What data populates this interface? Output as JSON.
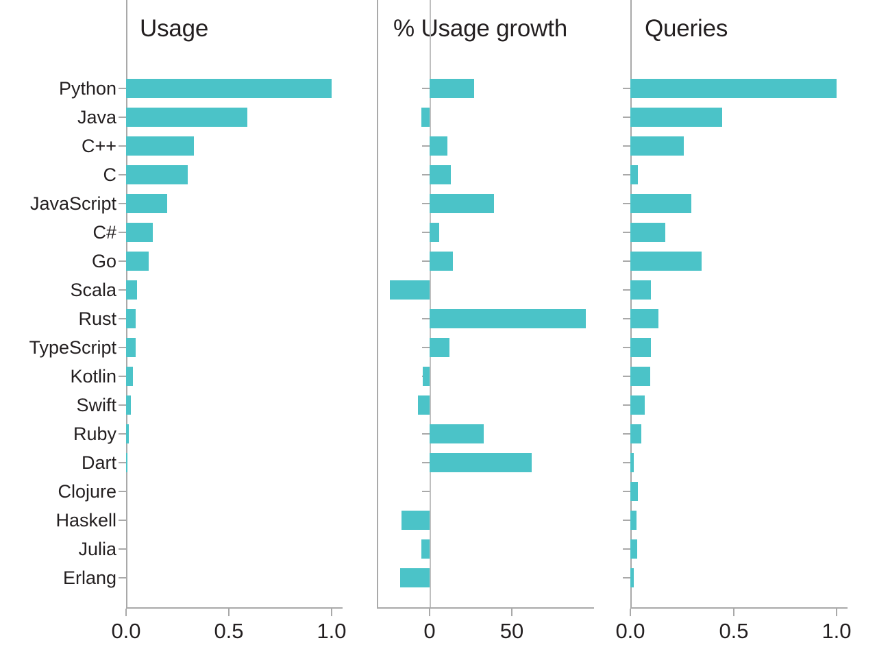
{
  "figure": {
    "background": "#ffffff",
    "bar_color": "#4bc3c8",
    "axis_color": "#a9a9a9",
    "text_color": "#231f20"
  },
  "panels": [
    {
      "title": "Usage"
    },
    {
      "title": "% Usage growth"
    },
    {
      "title": "Queries"
    }
  ],
  "categories": [
    "Python",
    "Java",
    "C++",
    "C",
    "JavaScript",
    "C#",
    "Go",
    "Scala",
    "Rust",
    "TypeScript",
    "Kotlin",
    "Swift",
    "Ruby",
    "Dart",
    "Clojure",
    "Haskell",
    "Julia",
    "Erlang"
  ],
  "axes": {
    "usage": {
      "ticks": [
        0.0,
        0.5,
        1.0
      ],
      "tick_labels": [
        "0.0",
        "0.5",
        "1.0"
      ],
      "min": 0.0,
      "max": 1.0
    },
    "growth": {
      "ticks": [
        0,
        50
      ],
      "tick_labels": [
        "0",
        "50"
      ],
      "min": -32,
      "max": 100
    },
    "queries": {
      "ticks": [
        0.0,
        0.5,
        1.0
      ],
      "tick_labels": [
        "0.0",
        "0.5",
        "1.0"
      ],
      "min": 0.0,
      "max": 1.0
    }
  },
  "chart_data": {
    "type": "bar",
    "title": "",
    "orientation": "horizontal",
    "grid": false,
    "legend": null,
    "categories": [
      "Python",
      "Java",
      "C++",
      "C",
      "JavaScript",
      "C#",
      "Go",
      "Scala",
      "Rust",
      "TypeScript",
      "Kotlin",
      "Swift",
      "Ruby",
      "Dart",
      "Clojure",
      "Haskell",
      "Julia",
      "Erlang"
    ],
    "panels": [
      {
        "title": "Usage",
        "xlabel": "",
        "ylabel": "",
        "xlim": [
          0.0,
          1.0
        ],
        "xticks": [
          0.0,
          0.5,
          1.0
        ],
        "xtick_labels": [
          "0.0",
          "0.5",
          "1.0"
        ],
        "values": [
          1.0,
          0.59,
          0.33,
          0.3,
          0.2,
          0.13,
          0.11,
          0.053,
          0.045,
          0.045,
          0.033,
          0.023,
          0.012,
          0.004,
          0.0,
          0.0,
          0.0,
          0.0
        ]
      },
      {
        "title": "% Usage growth",
        "xlabel": "",
        "ylabel": "",
        "xlim": [
          -32,
          100
        ],
        "xticks": [
          0,
          50
        ],
        "xtick_labels": [
          "0",
          "50"
        ],
        "values": [
          27,
          -5,
          11,
          13,
          39,
          6,
          14,
          -24,
          95,
          12,
          -4,
          -7,
          33,
          62,
          0,
          -17,
          -5,
          -18
        ]
      },
      {
        "title": "Queries",
        "xlabel": "",
        "ylabel": "",
        "xlim": [
          0.0,
          1.0
        ],
        "xticks": [
          0.0,
          0.5,
          1.0
        ],
        "xtick_labels": [
          "0.0",
          "0.5",
          "1.0"
        ],
        "values": [
          1.0,
          0.445,
          0.26,
          0.037,
          0.295,
          0.17,
          0.345,
          0.1,
          0.135,
          0.1,
          0.097,
          0.07,
          0.053,
          0.017,
          0.035,
          0.03,
          0.033,
          0.015
        ]
      }
    ]
  }
}
